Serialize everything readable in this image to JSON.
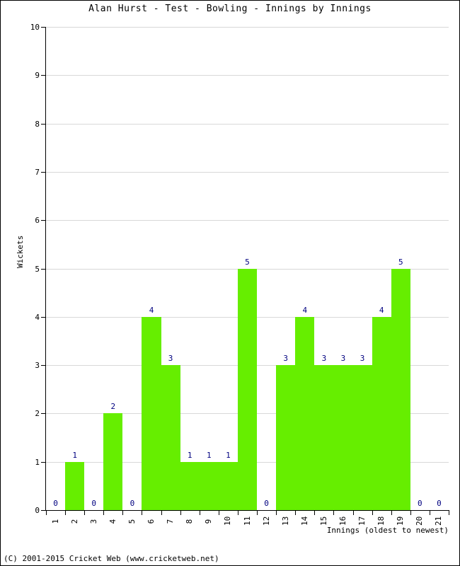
{
  "chart_data": {
    "type": "bar",
    "title": "Alan Hurst - Test - Bowling - Innings by Innings",
    "xlabel": "Innings (oldest to newest)",
    "ylabel": "Wickets",
    "categories": [
      "1",
      "2",
      "3",
      "4",
      "5",
      "6",
      "7",
      "8",
      "9",
      "10",
      "11",
      "12",
      "13",
      "14",
      "15",
      "16",
      "17",
      "18",
      "19",
      "20",
      "21"
    ],
    "values": [
      0,
      1,
      0,
      2,
      0,
      4,
      3,
      1,
      1,
      1,
      5,
      0,
      3,
      4,
      3,
      3,
      3,
      4,
      5,
      0,
      0
    ],
    "ylim": [
      0,
      10
    ],
    "yticks": [
      "0",
      "1",
      "2",
      "3",
      "4",
      "5",
      "6",
      "7",
      "8",
      "9",
      "10"
    ],
    "grid": true,
    "legend": false,
    "bar_color": "#66ee00",
    "value_label_color": "#000080",
    "grid_color": "#d8d8d8",
    "axis_color": "#000000"
  },
  "footer": {
    "copyright": "(C) 2001-2015 Cricket Web (www.cricketweb.net)"
  }
}
